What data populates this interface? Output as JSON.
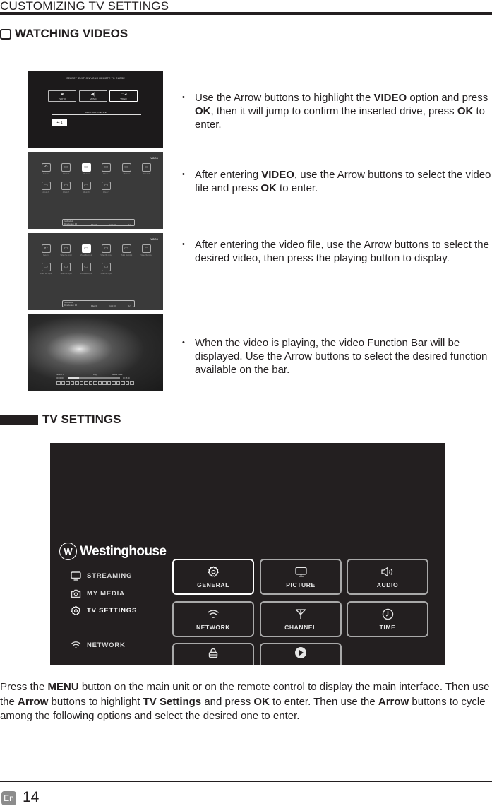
{
  "header": {
    "title": "CUSTOMIZING TV SETTINGS"
  },
  "section_watching": {
    "title": "WATCHING VIDEOS",
    "screens": {
      "source_select": {
        "header_text": "SELECT 'EXIT' ON YOUR REMOTE TO CLOSE",
        "sources": [
          {
            "label": "PHOTO",
            "icon": "camera-icon"
          },
          {
            "label": "MUSIC",
            "icon": "speaker-icon"
          },
          {
            "label": "VIDEO",
            "icon": "video-camera-icon",
            "selected": true
          }
        ],
        "device_label": "REMOVABLE DEVICE",
        "usb_label": "1"
      },
      "album_browser": {
        "tag": "VIDEO",
        "items": [
          "Return",
          "Album 1",
          "Album 2",
          "Album 3",
          "Album 4",
          "Album 5",
          "Album 6",
          "Album 7",
          "Album 8",
          "Album 9"
        ],
        "selected_index": 2,
        "info": {
          "path": "/usb/sda1",
          "directories": "Directories: 10",
          "files": "Files:0",
          "total": "Total:10",
          "page": "1/1"
        }
      },
      "file_browser": {
        "tag": "VIDEO",
        "items": [
          "Return",
          "Video file input",
          "Video file input",
          "Video file input",
          "Video file input",
          "Video file input",
          "Video file input",
          "Video file input",
          "Video file input",
          "Video file input"
        ],
        "selected_index": 2,
        "info": {
          "path": "/usb/sda1",
          "directories": "Directories: 10",
          "files": "Files:0",
          "total": "Total:10",
          "page": "1/1"
        }
      },
      "playback": {
        "progress_fraction": 0.2,
        "left_label": "Source: 2",
        "mid_label": "Play",
        "right_label": "Repeat: None",
        "start_time": "00:00:00",
        "end_time": "00:15:00"
      }
    },
    "bullets": [
      {
        "parts": [
          {
            "text": "Use the Arrow buttons to highlight the ",
            "bold": false
          },
          {
            "text": "VIDEO",
            "bold": true
          },
          {
            "text": " option and press ",
            "bold": false
          },
          {
            "text": "OK",
            "bold": true
          },
          {
            "text": ", then it will jump to confirm the inserted drive, press ",
            "bold": false
          },
          {
            "text": "OK",
            "bold": true
          },
          {
            "text": " to enter.",
            "bold": false
          }
        ]
      },
      {
        "parts": [
          {
            "text": "After entering ",
            "bold": false
          },
          {
            "text": "VIDEO",
            "bold": true
          },
          {
            "text": ", use the Arrow buttons to select the video file and press ",
            "bold": false
          },
          {
            "text": "OK",
            "bold": true
          },
          {
            "text": " to enter.",
            "bold": false
          }
        ]
      },
      {
        "parts": [
          {
            "text": "After entering the video file, use the Arrow buttons to select the desired video, then press the playing button to display.",
            "bold": false
          }
        ]
      },
      {
        "parts": [
          {
            "text": "When the video is playing, the video Function Bar will be displayed. Use the Arrow buttons to select the desired function available on the bar.",
            "bold": false
          }
        ]
      }
    ]
  },
  "section_tv_settings": {
    "title": "TV SETTINGS",
    "tv_menu": {
      "brand": "Westinghouse",
      "nav": [
        {
          "label": "STREAMING",
          "icon": "monitor-icon"
        },
        {
          "label": "MY MEDIA",
          "icon": "camera-icon"
        },
        {
          "label": "TV SETTINGS",
          "icon": "gear-icon",
          "active": true
        },
        {
          "label": "NETWORK",
          "icon": "wifi-icon"
        }
      ],
      "tiles": [
        {
          "label": "GENERAL",
          "icon": "gear-icon",
          "selected": true
        },
        {
          "label": "PICTURE",
          "icon": "monitor-icon"
        },
        {
          "label": "AUDIO",
          "icon": "speaker-icon"
        },
        {
          "label": "NETWORK",
          "icon": "wifi-icon"
        },
        {
          "label": "CHANNEL",
          "icon": "antenna-icon"
        },
        {
          "label": "TIME",
          "icon": "clock-icon"
        },
        {
          "label": "",
          "icon": "lock-icon"
        },
        {
          "label": "",
          "icon": "play-circle-icon"
        }
      ]
    },
    "paragraph": [
      {
        "text": "Press the ",
        "bold": false
      },
      {
        "text": "MENU",
        "bold": true
      },
      {
        "text": " button on the main unit or on the remote control to display the main interface. Then use the ",
        "bold": false
      },
      {
        "text": "Arrow",
        "bold": true
      },
      {
        "text": " buttons to highlight ",
        "bold": false
      },
      {
        "text": "TV Settings",
        "bold": true
      },
      {
        "text": " and press ",
        "bold": false
      },
      {
        "text": "OK",
        "bold": true
      },
      {
        "text": " to enter. Then use the ",
        "bold": false
      },
      {
        "text": "Arrow",
        "bold": true
      },
      {
        "text": " buttons to cycle among the following options and select the desired one to enter.",
        "bold": false
      }
    ]
  },
  "footer": {
    "language": "En",
    "page_number": "14"
  }
}
